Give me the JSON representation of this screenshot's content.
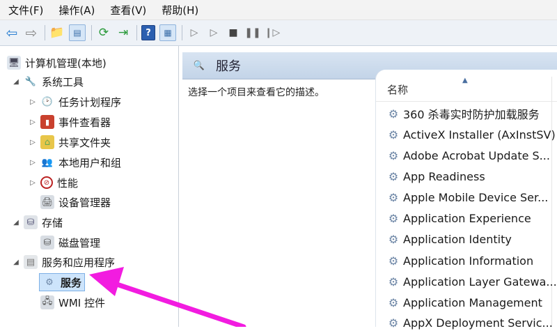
{
  "menubar": {
    "items": [
      "文件(F)",
      "操作(A)",
      "查看(V)",
      "帮助(H)"
    ]
  },
  "toolbar": {
    "help_label": "?"
  },
  "tree": {
    "root": "计算机管理(本地)",
    "system_tools": "系统工具",
    "task_scheduler": "任务计划程序",
    "event_viewer": "事件查看器",
    "shared_folders": "共享文件夹",
    "local_users": "本地用户和组",
    "performance": "性能",
    "device_manager": "设备管理器",
    "storage": "存储",
    "disk_management": "磁盘管理",
    "services_apps": "服务和应用程序",
    "services": "服务",
    "wmi": "WMI 控件"
  },
  "pane": {
    "title": "服务",
    "description": "选择一个项目来查看它的描述。",
    "column_name": "名称",
    "services": [
      "360 杀毒实时防护加载服务",
      "ActiveX Installer (AxInstSV)",
      "Adobe Acrobat Update S...",
      "App Readiness",
      "Apple Mobile Device Ser...",
      "Application Experience",
      "Application Identity",
      "Application Information",
      "Application Layer Gatewa...",
      "Application Management",
      "AppX Deployment Servic..."
    ]
  },
  "colors": {
    "annotation_arrow": "#f21ce0",
    "selection": "#cde4fb"
  }
}
